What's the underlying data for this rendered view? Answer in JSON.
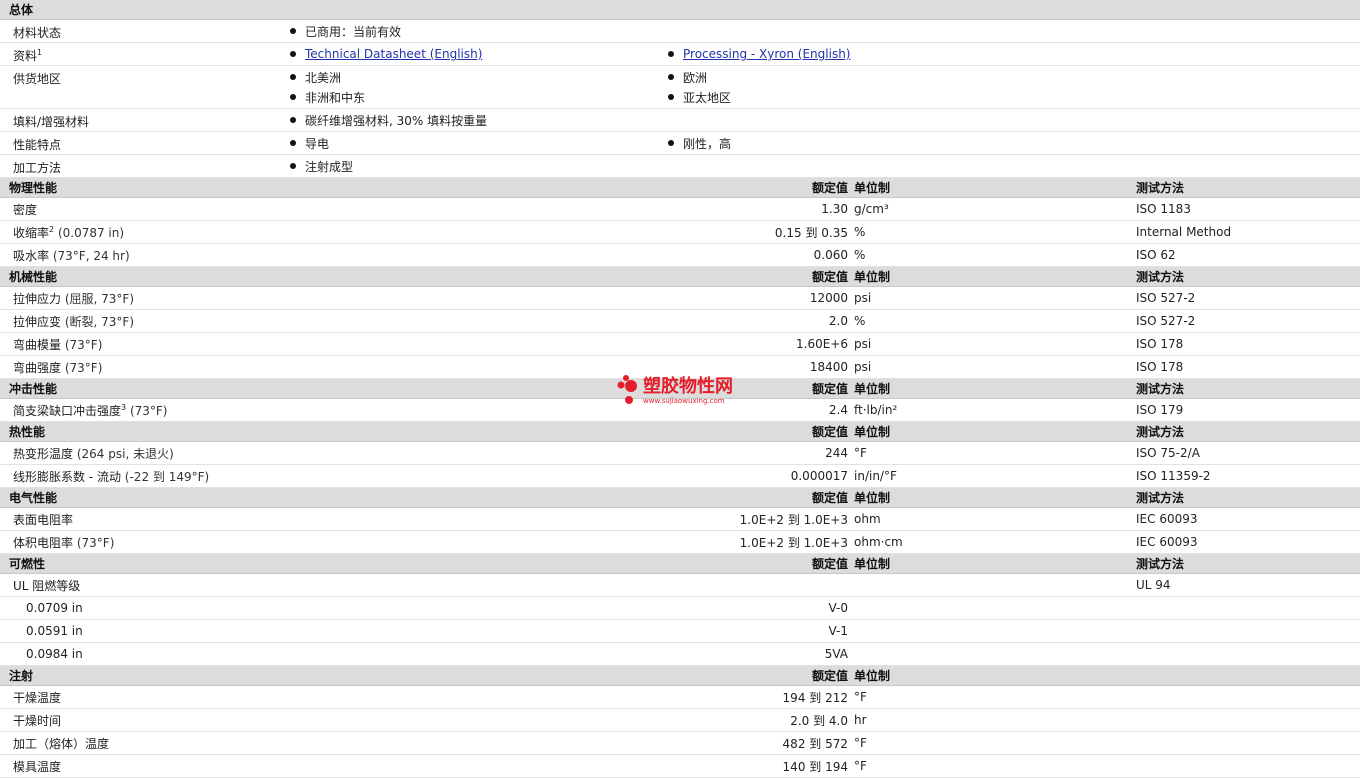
{
  "general": {
    "title": "总体",
    "rows": [
      {
        "label": "材料状态",
        "items": [
          {
            "text": "已商用：当前有效"
          }
        ]
      },
      {
        "label": "资料",
        "sup": "1",
        "items": [
          {
            "text": "Technical Datasheet (English)",
            "link": true
          },
          {
            "text": "Processing - Xyron (English)",
            "link": true
          }
        ]
      },
      {
        "label": "供货地区",
        "items": [
          {
            "text": "北美洲"
          },
          {
            "text": "欧洲"
          },
          {
            "text": "非洲和中东"
          },
          {
            "text": "亚太地区"
          }
        ]
      },
      {
        "label": "填料/增强材料",
        "items": [
          {
            "text": "碳纤维增强材料, 30% 填料按重量"
          }
        ]
      },
      {
        "label": "性能特点",
        "items": [
          {
            "text": "导电"
          },
          {
            "text": "刚性，高"
          }
        ]
      },
      {
        "label": "加工方法",
        "items": [
          {
            "text": "注射成型"
          }
        ]
      }
    ]
  },
  "columns": {
    "value": "额定值",
    "unit": "单位制",
    "test": "测试方法"
  },
  "sections": [
    {
      "title": "物理性能",
      "show_test": true,
      "rows": [
        {
          "label": "密度",
          "value": "1.30",
          "unit": "g/cm³",
          "test": "ISO 1183"
        },
        {
          "label": "收缩率",
          "sup": "2",
          "cond": "(0.0787 in)",
          "value": "0.15 到  0.35",
          "unit": "%",
          "test": "Internal Method"
        },
        {
          "label": "吸水率",
          "cond": "(73°F, 24 hr)",
          "value": "0.060",
          "unit": "%",
          "test": "ISO 62"
        }
      ]
    },
    {
      "title": "机械性能",
      "show_test": true,
      "rows": [
        {
          "label": "拉伸应力",
          "cond": "(屈服, 73°F)",
          "value": "12000",
          "unit": "psi",
          "test": "ISO 527-2"
        },
        {
          "label": "拉伸应变",
          "cond": "(断裂, 73°F)",
          "value": "2.0",
          "unit": "%",
          "test": "ISO 527-2"
        },
        {
          "label": "弯曲模量",
          "cond": "(73°F)",
          "value": "1.60E+6",
          "unit": "psi",
          "test": "ISO 178"
        },
        {
          "label": "弯曲强度",
          "cond": "(73°F)",
          "value": "18400",
          "unit": "psi",
          "test": "ISO 178"
        }
      ]
    },
    {
      "title": "冲击性能",
      "show_test": true,
      "rows": [
        {
          "label": "简支梁缺口冲击强度",
          "sup": "3",
          "cond": "(73°F)",
          "value": "2.4",
          "unit": "ft·lb/in²",
          "test": "ISO 179"
        }
      ]
    },
    {
      "title": "热性能",
      "show_test": true,
      "rows": [
        {
          "label": "热变形温度",
          "cond": "(264 psi, 未退火)",
          "value": "244",
          "unit": "°F",
          "test": "ISO 75-2/A"
        },
        {
          "label": "线形膨胀系数 - 流动",
          "cond": "(-22 到  149°F)",
          "value": "0.000017",
          "unit": "in/in/°F",
          "test": "ISO 11359-2"
        }
      ]
    },
    {
      "title": "电气性能",
      "show_test": true,
      "rows": [
        {
          "label": "表面电阻率",
          "value": "1.0E+2 到  1.0E+3",
          "unit": "ohm",
          "test": "IEC 60093"
        },
        {
          "label": "体积电阻率",
          "cond": "(73°F)",
          "value": "1.0E+2 到  1.0E+3",
          "unit": "ohm·cm",
          "test": "IEC 60093"
        }
      ]
    },
    {
      "title": "可燃性",
      "show_test": true,
      "rows": [
        {
          "label": "UL 阻燃等级",
          "value": "",
          "unit": "",
          "test": "UL 94"
        },
        {
          "label": "0.0709 in",
          "sub": true,
          "value": "V-0",
          "unit": "",
          "test": ""
        },
        {
          "label": "0.0591 in",
          "sub": true,
          "value": "V-1",
          "unit": "",
          "test": ""
        },
        {
          "label": "0.0984 in",
          "sub": true,
          "value": "5VA",
          "unit": "",
          "test": ""
        }
      ]
    },
    {
      "title": "注射",
      "show_test": false,
      "rows": [
        {
          "label": "干燥温度",
          "value": "194 到  212",
          "unit": "°F",
          "test": ""
        },
        {
          "label": "干燥时间",
          "value": "2.0 到  4.0",
          "unit": "hr",
          "test": ""
        },
        {
          "label": "加工（熔体）温度",
          "value": "482 到  572",
          "unit": "°F",
          "test": ""
        },
        {
          "label": "模具温度",
          "value": "140 到  194",
          "unit": "°F",
          "test": ""
        }
      ]
    }
  ],
  "watermark": {
    "name": "塑胶物性网",
    "url": "www.sujiaowuxing.com",
    "color": "#e41e2b"
  }
}
